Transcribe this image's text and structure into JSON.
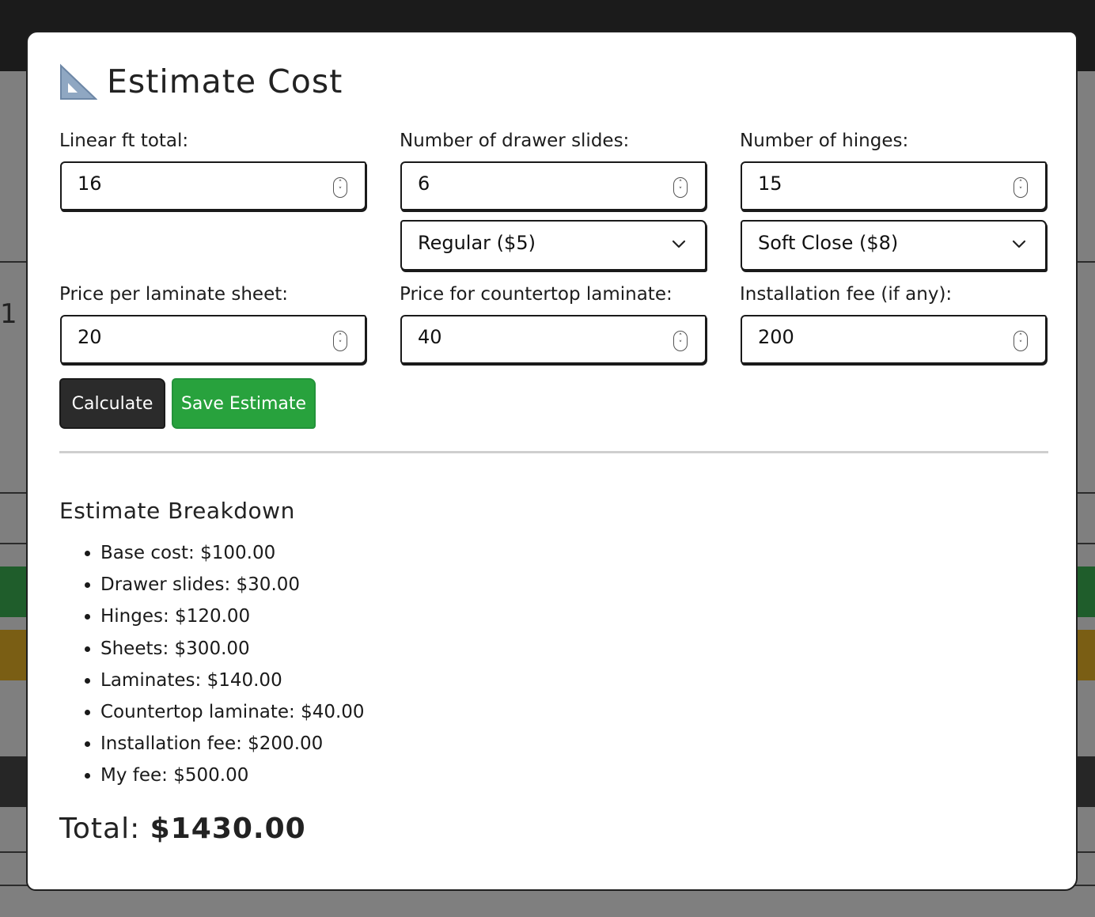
{
  "modal": {
    "title": "Estimate Cost",
    "title_icon": "triangle-ruler-icon"
  },
  "fields": {
    "linear_ft": {
      "label": "Linear ft total:",
      "value": "16"
    },
    "drawer_slides": {
      "label": "Number of drawer slides:",
      "value": "6",
      "type_selected": "Regular ($5)"
    },
    "hinges": {
      "label": "Number of hinges:",
      "value": "15",
      "type_selected": "Soft Close ($8)"
    },
    "laminate_sheet_price": {
      "label": "Price per laminate sheet:",
      "value": "20"
    },
    "countertop_laminate_price": {
      "label": "Price for countertop laminate:",
      "value": "40"
    },
    "installation_fee": {
      "label": "Installation fee (if any):",
      "value": "200"
    }
  },
  "buttons": {
    "calculate": "Calculate",
    "save": "Save Estimate"
  },
  "breakdown": {
    "title": "Estimate Breakdown",
    "items": [
      "Base cost: $100.00",
      "Drawer slides: $30.00",
      "Hinges: $120.00",
      "Sheets: $300.00",
      "Laminates: $140.00",
      "Countertop laminate: $40.00",
      "Installation fee: $200.00",
      "My fee: $500.00"
    ],
    "total_label": "Total:",
    "total_value": "$1430.00"
  },
  "background": {
    "partial_glyph": "1"
  },
  "colors": {
    "calculate_button": "#2b2b2b",
    "save_button": "#28a23d",
    "overlay": "#7f7f7f"
  }
}
